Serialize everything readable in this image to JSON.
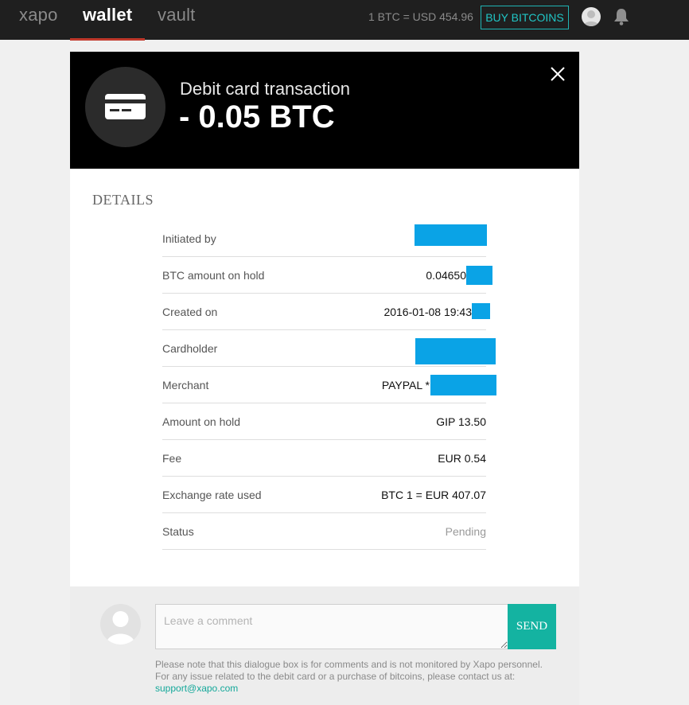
{
  "nav": {
    "items": [
      {
        "label": "xapo"
      },
      {
        "label": "wallet"
      },
      {
        "label": "vault"
      }
    ],
    "rate": "1 BTC = USD 454.96",
    "buy_button": "BUY BITCOINS",
    "active_color": "#c0392b"
  },
  "transaction": {
    "title": "Debit card transaction",
    "amount": "- 0.05 BTC",
    "icon": "credit-card-icon"
  },
  "details": {
    "heading": "DETAILS",
    "rows": [
      {
        "label": "Initiated by",
        "value": ""
      },
      {
        "label": "BTC amount on hold",
        "value": "0.04650"
      },
      {
        "label": "Created on",
        "value": "2016-01-08 19:43"
      },
      {
        "label": "Cardholder",
        "value": ""
      },
      {
        "label": "Merchant",
        "value": "PAYPAL *"
      },
      {
        "label": "Amount on hold",
        "value": "GIP 13.50"
      },
      {
        "label": "Fee",
        "value": "EUR 0.54"
      },
      {
        "label": "Exchange rate used",
        "value": "BTC 1 = EUR 407.07"
      },
      {
        "label": "Status",
        "value": "Pending"
      }
    ],
    "redaction_color": "#0aa3e6"
  },
  "comment": {
    "placeholder": "Leave a comment",
    "value": "",
    "send_label": "SEND",
    "note_line1": "Please note that this dialogue box is for comments and is not monitored by Xapo personnel.",
    "note_line2": "For any issue related to the debit card or a purchase of bitcoins, please contact us at:",
    "support_email": "support@xapo.com",
    "accent_color": "#14b3a1"
  }
}
